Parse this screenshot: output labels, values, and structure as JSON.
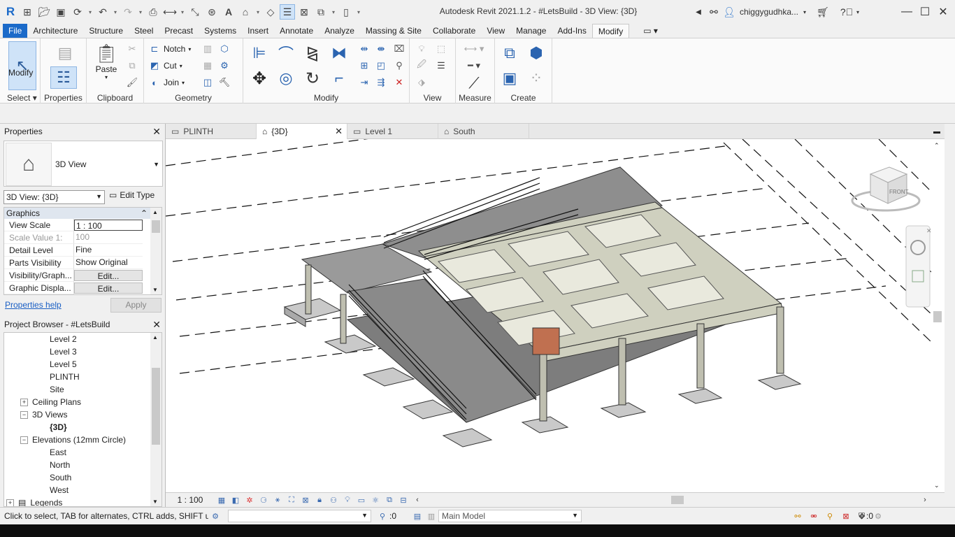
{
  "app": {
    "title": "Autodesk Revit 2021.1.2 - #LetsBuild - 3D View: {3D}",
    "username": "chiggygudhka...",
    "colors": {
      "file_tab": "#1b6ac9",
      "link": "#1a5fc4",
      "selected_tool": "#cfe3f8"
    }
  },
  "ribbon": {
    "tabs": [
      "File",
      "Architecture",
      "Structure",
      "Steel",
      "Precast",
      "Systems",
      "Insert",
      "Annotate",
      "Analyze",
      "Massing & Site",
      "Collaborate",
      "View",
      "Manage",
      "Add-Ins",
      "Modify"
    ],
    "active_tab": "Modify",
    "panels": {
      "select": {
        "label": "Select",
        "modify_label": "Modify"
      },
      "properties": {
        "label": "Properties"
      },
      "clipboard": {
        "label": "Clipboard",
        "paste_label": "Paste"
      },
      "geometry": {
        "label": "Geometry",
        "notch": "Notch",
        "cut": "Cut",
        "join": "Join"
      },
      "modify": {
        "label": "Modify"
      },
      "view": {
        "label": "View"
      },
      "measure": {
        "label": "Measure"
      },
      "create": {
        "label": "Create"
      }
    }
  },
  "properties_panel": {
    "title": "Properties",
    "type_name": "3D View",
    "instance_selector": "3D View: {3D}",
    "edit_type": "Edit Type",
    "group": "Graphics",
    "rows": [
      {
        "key": "View Scale",
        "value": "1 : 100"
      },
      {
        "key": "Scale Value   1:",
        "value": "100"
      },
      {
        "key": "Detail Level",
        "value": "Fine"
      },
      {
        "key": "Parts Visibility",
        "value": "Show Original"
      },
      {
        "key": "Visibility/Graph...",
        "value": "Edit..."
      },
      {
        "key": "Graphic Displa...",
        "value": "Edit..."
      }
    ],
    "help_link": "Properties help",
    "apply": "Apply"
  },
  "project_browser": {
    "title": "Project Browser - #LetsBuild",
    "items": [
      {
        "label": "Level 2"
      },
      {
        "label": "Level 3"
      },
      {
        "label": "Level 5"
      },
      {
        "label": "PLINTH"
      },
      {
        "label": "Site"
      },
      {
        "label": "Ceiling Plans",
        "expander": "+"
      },
      {
        "label": "3D Views",
        "expander": "−"
      },
      {
        "label": "{3D}"
      },
      {
        "label": "Elevations (12mm Circle)",
        "expander": "−"
      },
      {
        "label": "East"
      },
      {
        "label": "North"
      },
      {
        "label": "South"
      },
      {
        "label": "West"
      },
      {
        "label": "Legends",
        "expander": "+"
      }
    ]
  },
  "view_tabs": [
    {
      "label": "PLINTH",
      "icon": "plan-view-icon"
    },
    {
      "label": "{3D}",
      "icon": "3d-view-icon",
      "active": true
    },
    {
      "label": "Level 1",
      "icon": "plan-view-icon"
    },
    {
      "label": "South",
      "icon": "elevation-view-icon"
    }
  ],
  "viewcube": {
    "face_label": "FRONT"
  },
  "view_control_bar": {
    "scale": "1 : 100"
  },
  "status_bar": {
    "message": "Click to select, TAB for alternates, CTRL adds, SHIFT unse",
    "filter_count": ":0",
    "workset_count": ":0",
    "model": "Main Model"
  }
}
